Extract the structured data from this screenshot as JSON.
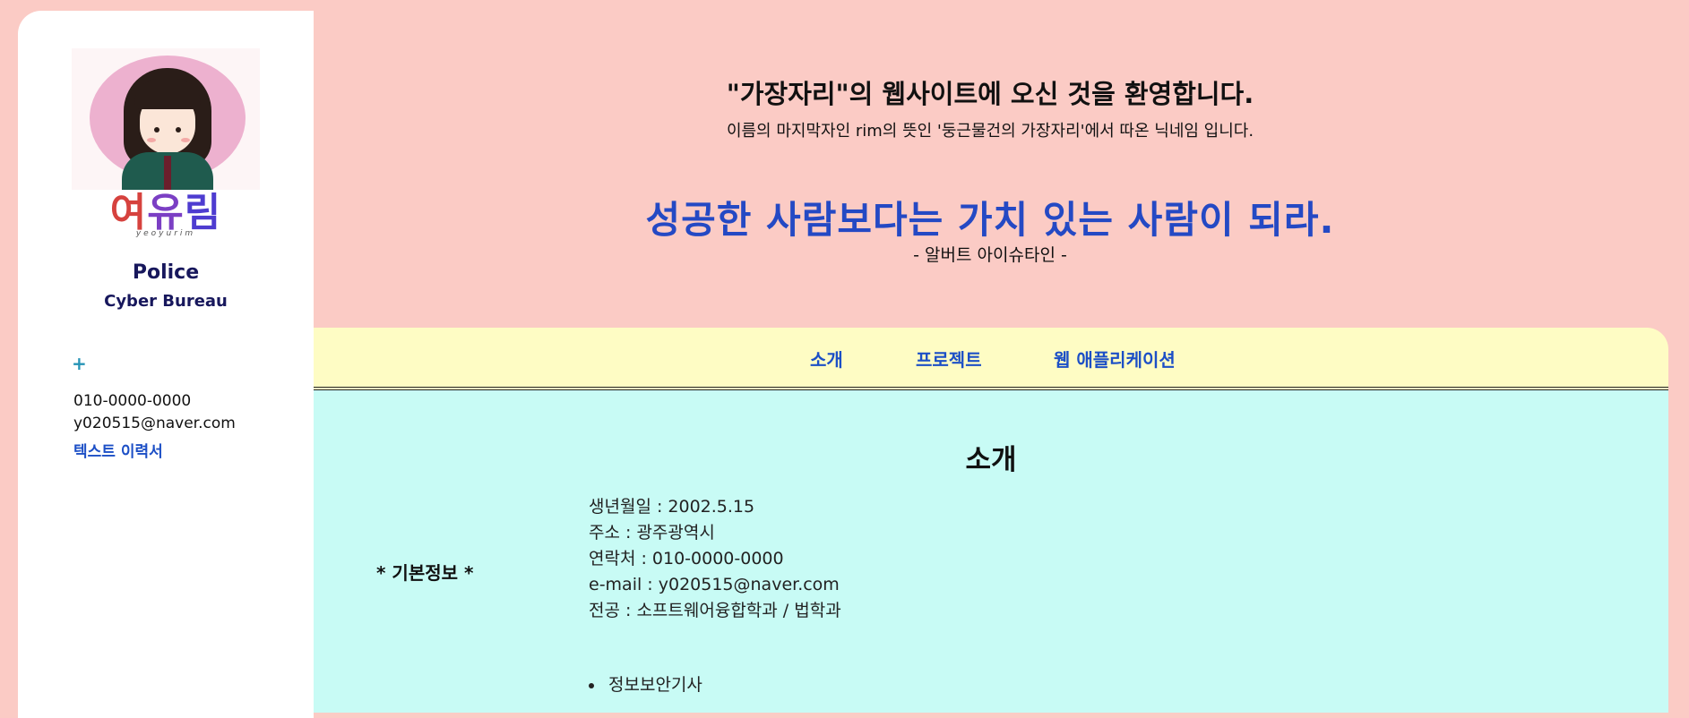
{
  "sidebar": {
    "logo": {
      "c1": "여",
      "c2": "유",
      "c3": "림",
      "sub": "yeoyurim"
    },
    "org_line1": "Police",
    "org_line2": "Cyber Bureau",
    "plus_label": "+",
    "phone": "010-0000-0000",
    "email": "y020515@naver.com",
    "resume_link": "텍스트 이력서"
  },
  "hero": {
    "welcome": "\"가장자리\"의 웹사이트에 오신 것을 환영합니다.",
    "subtitle": "이름의 마지막자인 rim의 뜻인 '둥근물건의 가장자리'에서 따온 닉네임 입니다.",
    "quote": "성공한 사람보다는 가치 있는 사람이 되라.",
    "quote_author": "- 알버트 아이슈타인 -"
  },
  "nav": {
    "items": [
      {
        "label": "소개"
      },
      {
        "label": "프로젝트"
      },
      {
        "label": "웹 애플리케이션"
      }
    ]
  },
  "main": {
    "section_title": "소개",
    "basic_label": "* 기본정보 *",
    "info": [
      "생년월일 : 2002.5.15",
      "주소 : 광주광역시",
      "연락처 : 010-0000-0000",
      "e-mail : y020515@naver.com",
      "전공 : 소프트웨어융합학과 / 법학과"
    ],
    "certs": [
      "정보보안기사"
    ]
  },
  "colors": {
    "page_bg": "#fbcbc5",
    "nav_bg": "#fefcc4",
    "content_bg": "#c8fbf5",
    "link": "#1c4fc6",
    "quote": "#2449c4",
    "org": "#17175c"
  }
}
